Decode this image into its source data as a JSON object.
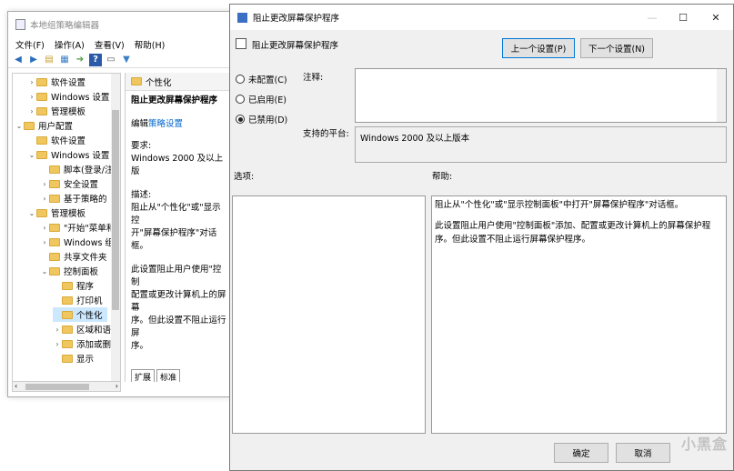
{
  "gpedit": {
    "title": "本地组策略编辑器",
    "menu": [
      "文件(F)",
      "操作(A)",
      "查看(V)",
      "帮助(H)"
    ],
    "tree": [
      {
        "label": "软件设置",
        "indent": 1,
        "chev": "›"
      },
      {
        "label": "Windows 设置",
        "indent": 1,
        "chev": "›"
      },
      {
        "label": "管理模板",
        "indent": 1,
        "chev": "›"
      },
      {
        "label": "用户配置",
        "indent": 0,
        "chev": "⌄"
      },
      {
        "label": "软件设置",
        "indent": 1,
        "chev": ""
      },
      {
        "label": "Windows 设置",
        "indent": 1,
        "chev": "⌄"
      },
      {
        "label": "脚本(登录/注",
        "indent": 2,
        "chev": ""
      },
      {
        "label": "安全设置",
        "indent": 2,
        "chev": "›"
      },
      {
        "label": "基于策略的",
        "indent": 2,
        "chev": "›"
      },
      {
        "label": "管理模板",
        "indent": 1,
        "chev": "⌄"
      },
      {
        "label": "\"开始\"菜单和",
        "indent": 2,
        "chev": "›"
      },
      {
        "label": "Windows 组",
        "indent": 2,
        "chev": "›"
      },
      {
        "label": "共享文件夹",
        "indent": 2,
        "chev": ""
      },
      {
        "label": "控制面板",
        "indent": 2,
        "chev": "⌄"
      },
      {
        "label": "程序",
        "indent": 3,
        "chev": ""
      },
      {
        "label": "打印机",
        "indent": 3,
        "chev": ""
      },
      {
        "label": "个性化",
        "indent": 3,
        "chev": "",
        "selected": true
      },
      {
        "label": "区域和语",
        "indent": 3,
        "chev": "›"
      },
      {
        "label": "添加或删",
        "indent": 3,
        "chev": "›"
      },
      {
        "label": "显示",
        "indent": 3,
        "chev": ""
      }
    ],
    "detail": {
      "header": "个性化",
      "policy_title": "阻止更改屏幕保护程序",
      "edit_prefix": "编辑",
      "edit_link": "策略设置",
      "req_label": "要求:",
      "req_value": "Windows 2000 及以上版",
      "desc_label": "描述:",
      "desc_1": "阻止从\"个性化\"或\"显示控",
      "desc_2": "开\"屏幕保护程序\"对话框。",
      "desc_3": "此设置阻止用户使用\"控制",
      "desc_4": "配置或更改计算机上的屏幕",
      "desc_5": "序。但此设置不阻止运行屏",
      "desc_6": "序。",
      "tabs": [
        "扩展",
        "标准"
      ]
    }
  },
  "dialog": {
    "title": "阻止更改屏幕保护程序",
    "policy_name": "阻止更改屏幕保护程序",
    "prev_button": "上一个设置(P)",
    "next_button": "下一个设置(N)",
    "radios": {
      "not_configured": "未配置(C)",
      "enabled": "已启用(E)",
      "disabled": "已禁用(D)",
      "selected": "disabled"
    },
    "comment_label": "注释:",
    "platform_label": "支持的平台:",
    "platform_value": "Windows 2000 及以上版本",
    "options_label": "选项:",
    "help_label": "帮助:",
    "help_p1": "阻止从\"个性化\"或\"显示控制面板\"中打开\"屏幕保护程序\"对话框。",
    "help_p2": "此设置阻止用户使用\"控制面板\"添加、配置或更改计算机上的屏幕保护程序。但此设置不阻止运行屏幕保护程序。",
    "ok_button": "确定",
    "cancel_button": "取消",
    "watermark": "小黑盒"
  }
}
